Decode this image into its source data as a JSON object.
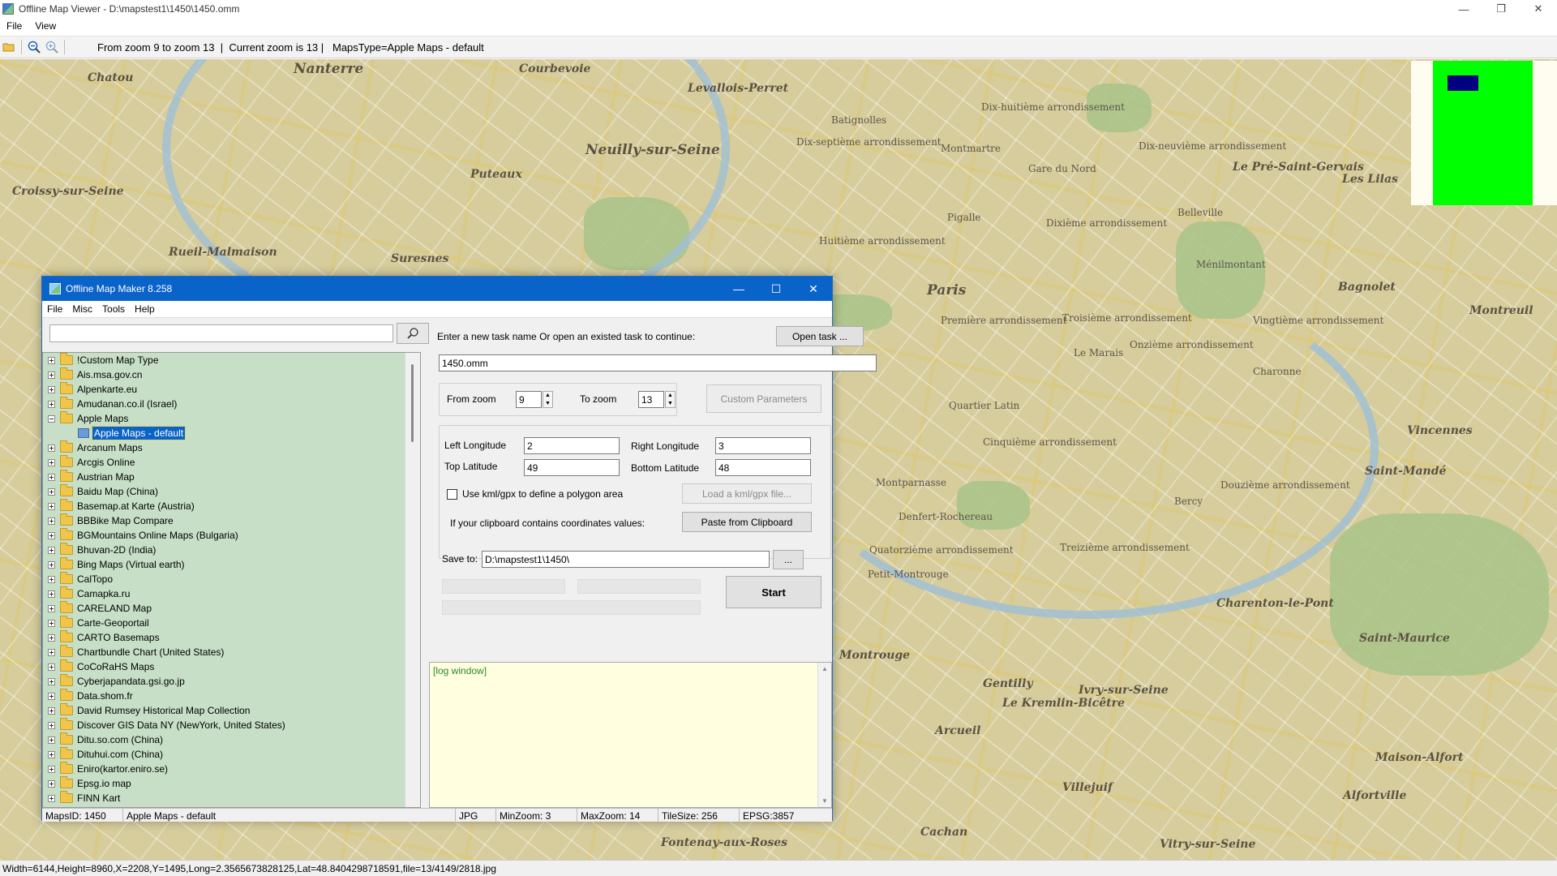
{
  "window": {
    "title": "Offline Map Viewer - D:\\mapstest1\\1450\\1450.omm",
    "minimize": "—",
    "maximize": "❐",
    "close": "✕"
  },
  "menu": [
    "File",
    "View"
  ],
  "toolbar": {
    "zoom_range": "From zoom 9 to zoom 13",
    "sep": "  |  ",
    "current_zoom": "Current zoom is 13",
    "sep2": " |   ",
    "maps_type": "MapsType=Apple Maps - default"
  },
  "map_labels": [
    {
      "text": "Nanterre",
      "cls": "big"
    },
    {
      "text": "Courbevoie",
      "cls": "med"
    },
    {
      "text": "Chatou",
      "cls": "med"
    },
    {
      "text": "Levallois-Perret",
      "cls": "med"
    },
    {
      "text": "Neuilly-sur-Seine",
      "cls": "big"
    },
    {
      "text": "Puteaux",
      "cls": "med"
    },
    {
      "text": "Croissy-sur-Seine",
      "cls": "med"
    },
    {
      "text": "Rueil-Malmaison",
      "cls": "med"
    },
    {
      "text": "Suresnes",
      "cls": "med"
    },
    {
      "text": "Paris",
      "cls": "big"
    },
    {
      "text": "Bagnolet",
      "cls": "med"
    },
    {
      "text": "Montreuil",
      "cls": "med"
    },
    {
      "text": "Vincennes",
      "cls": "med"
    },
    {
      "text": "Saint-Mandé",
      "cls": "med"
    },
    {
      "text": "Charenton-le-Pont",
      "cls": "med"
    },
    {
      "text": "Saint-Maurice",
      "cls": "med"
    },
    {
      "text": "Maison-Alfort",
      "cls": "med"
    },
    {
      "text": "Alfortville",
      "cls": "med"
    },
    {
      "text": "Ivry-sur-Seine",
      "cls": "med"
    },
    {
      "text": "Le Kremlin-Bicêtre",
      "cls": "med"
    },
    {
      "text": "Gentilly",
      "cls": "med"
    },
    {
      "text": "Montrouge",
      "cls": "med"
    },
    {
      "text": "Arcueil",
      "cls": "med"
    },
    {
      "text": "Villejuif",
      "cls": "med"
    },
    {
      "text": "Cachan",
      "cls": "med"
    },
    {
      "text": "Fontenay-aux-Roses",
      "cls": "med"
    },
    {
      "text": "Vitry-sur-Seine",
      "cls": "med"
    },
    {
      "text": "Le Pré-Saint-Gervais",
      "cls": "med"
    },
    {
      "text": "Les Lilas",
      "cls": "med"
    },
    {
      "text": "Belleville",
      "cls": "small"
    },
    {
      "text": "Montmartre",
      "cls": "small"
    },
    {
      "text": "Batignolles",
      "cls": "small"
    },
    {
      "text": "Pigalle",
      "cls": "small"
    },
    {
      "text": "Dix-huitième arrondissement",
      "cls": "small"
    },
    {
      "text": "Dix-neuvième arrondissement",
      "cls": "small"
    },
    {
      "text": "Dix-septième arrondissement",
      "cls": "small"
    },
    {
      "text": "Dixième arrondissement",
      "cls": "small"
    },
    {
      "text": "Huitième arrondissement",
      "cls": "small"
    },
    {
      "text": "Vingtième arrondissement",
      "cls": "small"
    },
    {
      "text": "Ménilmontant",
      "cls": "small"
    },
    {
      "text": "Première arrondissement",
      "cls": "small"
    },
    {
      "text": "Troisième arrondissement",
      "cls": "small"
    },
    {
      "text": "Le Marais",
      "cls": "small"
    },
    {
      "text": "Onzième arrondissement",
      "cls": "small"
    },
    {
      "text": "Charonne",
      "cls": "small"
    },
    {
      "text": "Quartier Latin",
      "cls": "small"
    },
    {
      "text": "Montparnasse",
      "cls": "small"
    },
    {
      "text": "Cinquième arrondissement",
      "cls": "small"
    },
    {
      "text": "Douzième arrondissement",
      "cls": "small"
    },
    {
      "text": "Bercy",
      "cls": "small"
    },
    {
      "text": "Denfert-Rochereau",
      "cls": "small"
    },
    {
      "text": "Quatorzième arrondissement",
      "cls": "small"
    },
    {
      "text": "Treizième arrondissement",
      "cls": "small"
    },
    {
      "text": "Petit-Montrouge",
      "cls": "small"
    },
    {
      "text": "Gare du Nord",
      "cls": "small"
    }
  ],
  "statusbar": "Width=6144,Height=8960,X=2208,Y=1495,Long=2.3565673828125,Lat=48.8404298718591,file=13/4149/2818.jpg",
  "dialog": {
    "title": "Offline Map Maker 8.258",
    "minimize": "—",
    "maximize": "☐",
    "close": "✕",
    "menu": [
      "File",
      "Misc",
      "Tools",
      "Help"
    ],
    "search": {
      "value": ""
    },
    "tree": [
      {
        "label": "!Custom Map Type",
        "expanded": false
      },
      {
        "label": "Ais.msa.gov.cn",
        "expanded": false
      },
      {
        "label": "Alpenkarte.eu",
        "expanded": false
      },
      {
        "label": "Amudanan.co.il (Israel)",
        "expanded": false
      },
      {
        "label": "Apple Maps",
        "expanded": true
      },
      {
        "label": "Apple Maps - default",
        "child": true,
        "selected": true
      },
      {
        "label": "Arcanum Maps",
        "expanded": false
      },
      {
        "label": "Arcgis Online",
        "expanded": false
      },
      {
        "label": "Austrian Map",
        "expanded": false
      },
      {
        "label": "Baidu Map (China)",
        "expanded": false
      },
      {
        "label": "Basemap.at Karte (Austria)",
        "expanded": false
      },
      {
        "label": "BBBike Map Compare",
        "expanded": false
      },
      {
        "label": "BGMountains Online Maps (Bulgaria)",
        "expanded": false
      },
      {
        "label": "Bhuvan-2D (India)",
        "expanded": false
      },
      {
        "label": "Bing Maps (Virtual earth)",
        "expanded": false
      },
      {
        "label": "CalTopo",
        "expanded": false
      },
      {
        "label": "Camapka.ru",
        "expanded": false
      },
      {
        "label": "CARELAND Map",
        "expanded": false
      },
      {
        "label": "Carte-Geoportail",
        "expanded": false
      },
      {
        "label": "CARTO Basemaps",
        "expanded": false
      },
      {
        "label": "Chartbundle Chart (United States)",
        "expanded": false
      },
      {
        "label": "CoCoRaHS Maps",
        "expanded": false
      },
      {
        "label": "Cyberjapandata.gsi.go.jp",
        "expanded": false
      },
      {
        "label": "Data.shom.fr",
        "expanded": false
      },
      {
        "label": "David Rumsey Historical Map Collection",
        "expanded": false
      },
      {
        "label": "Discover GIS Data NY (NewYork, United States)",
        "expanded": false
      },
      {
        "label": "Ditu.so.com (China)",
        "expanded": false
      },
      {
        "label": "Dituhui.com (China)",
        "expanded": false
      },
      {
        "label": "Eniro(kartor.eniro.se)",
        "expanded": false
      },
      {
        "label": "Epsg.io map",
        "expanded": false
      },
      {
        "label": "FINN Kart",
        "expanded": false
      }
    ],
    "task_prompt": "Enter a new task name Or open an existed task to continue:",
    "open_task": "Open task ...",
    "task_name": "1450.omm",
    "from_zoom_label": "From zoom",
    "from_zoom": "9",
    "to_zoom_label": "To zoom",
    "to_zoom": "13",
    "custom_params": "Custom Parameters",
    "left_lon_label": "Left Longitude",
    "left_lon": "2",
    "right_lon_label": "Right Longitude",
    "right_lon": "3",
    "top_lat_label": "Top Latitude",
    "top_lat": "49",
    "bottom_lat_label": "Bottom Latitude",
    "bottom_lat": "48",
    "kml_check_label": "Use kml/gpx to define a polygon area",
    "load_kml": "Load a kml/gpx file...",
    "clipboard_label": "If your clipboard contains coordinates values:",
    "paste_clipboard": "Paste from Clipboard",
    "save_to_label": "Save to:",
    "save_to": "D:\\mapstest1\\1450\\",
    "browse": "...",
    "start": "Start",
    "log": "[log window]",
    "status": {
      "maps_id": "MapsID: 1450",
      "map_name": "Apple Maps - default",
      "format": "JPG",
      "min_zoom": "MinZoom: 3",
      "max_zoom": "MaxZoom: 14",
      "tile_size": "TileSize: 256",
      "epsg": "EPSG:3857"
    }
  }
}
